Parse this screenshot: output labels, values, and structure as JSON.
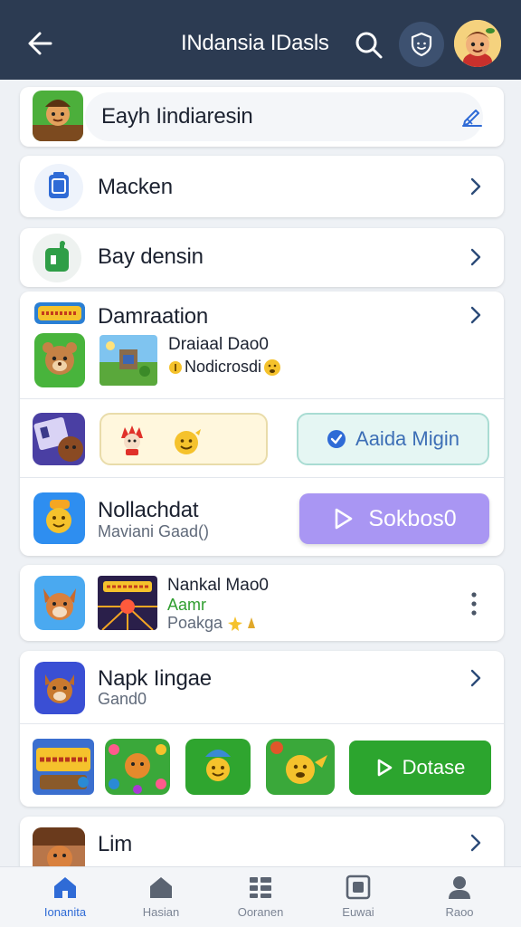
{
  "header": {
    "title": "INdansia IDasls"
  },
  "edit_row": {
    "label": "Eayh Iindiaresin"
  },
  "rows": {
    "macken": {
      "label": "Macken"
    },
    "bay": {
      "label": "Bay densin"
    },
    "dam": {
      "label": "Damraation",
      "game_title": "Draiaal Dao0",
      "game_sub": "Nodicrosdi"
    },
    "mint_button": {
      "label": "Aaida Migin"
    },
    "noll": {
      "label": "Nollachdat",
      "sub": "Maviani Gaad()",
      "button": "Sokbos0"
    },
    "nankal": {
      "title": "Nankal Mao0",
      "green": "Aamr",
      "sub": "Poakga"
    },
    "napk": {
      "label": "Napk Iingae",
      "sub": "Gand0",
      "button": "Dotase"
    },
    "lim": {
      "label": "Lim"
    }
  },
  "bottom_nav": [
    {
      "label": "Ionanita",
      "icon": "home-icon",
      "active": true
    },
    {
      "label": "Hasian",
      "icon": "house-icon",
      "active": false
    },
    {
      "label": "Ooranen",
      "icon": "grid-list-icon",
      "active": false
    },
    {
      "label": "Euwai",
      "icon": "square-icon",
      "active": false
    },
    {
      "label": "Raoo",
      "icon": "person-icon",
      "active": false
    }
  ],
  "colors": {
    "topbar": "#2c3b52",
    "accent_blue": "#2f6bd6",
    "purple": "#a996f3",
    "green": "#2ca52e",
    "mint": "#e5f6f3"
  }
}
